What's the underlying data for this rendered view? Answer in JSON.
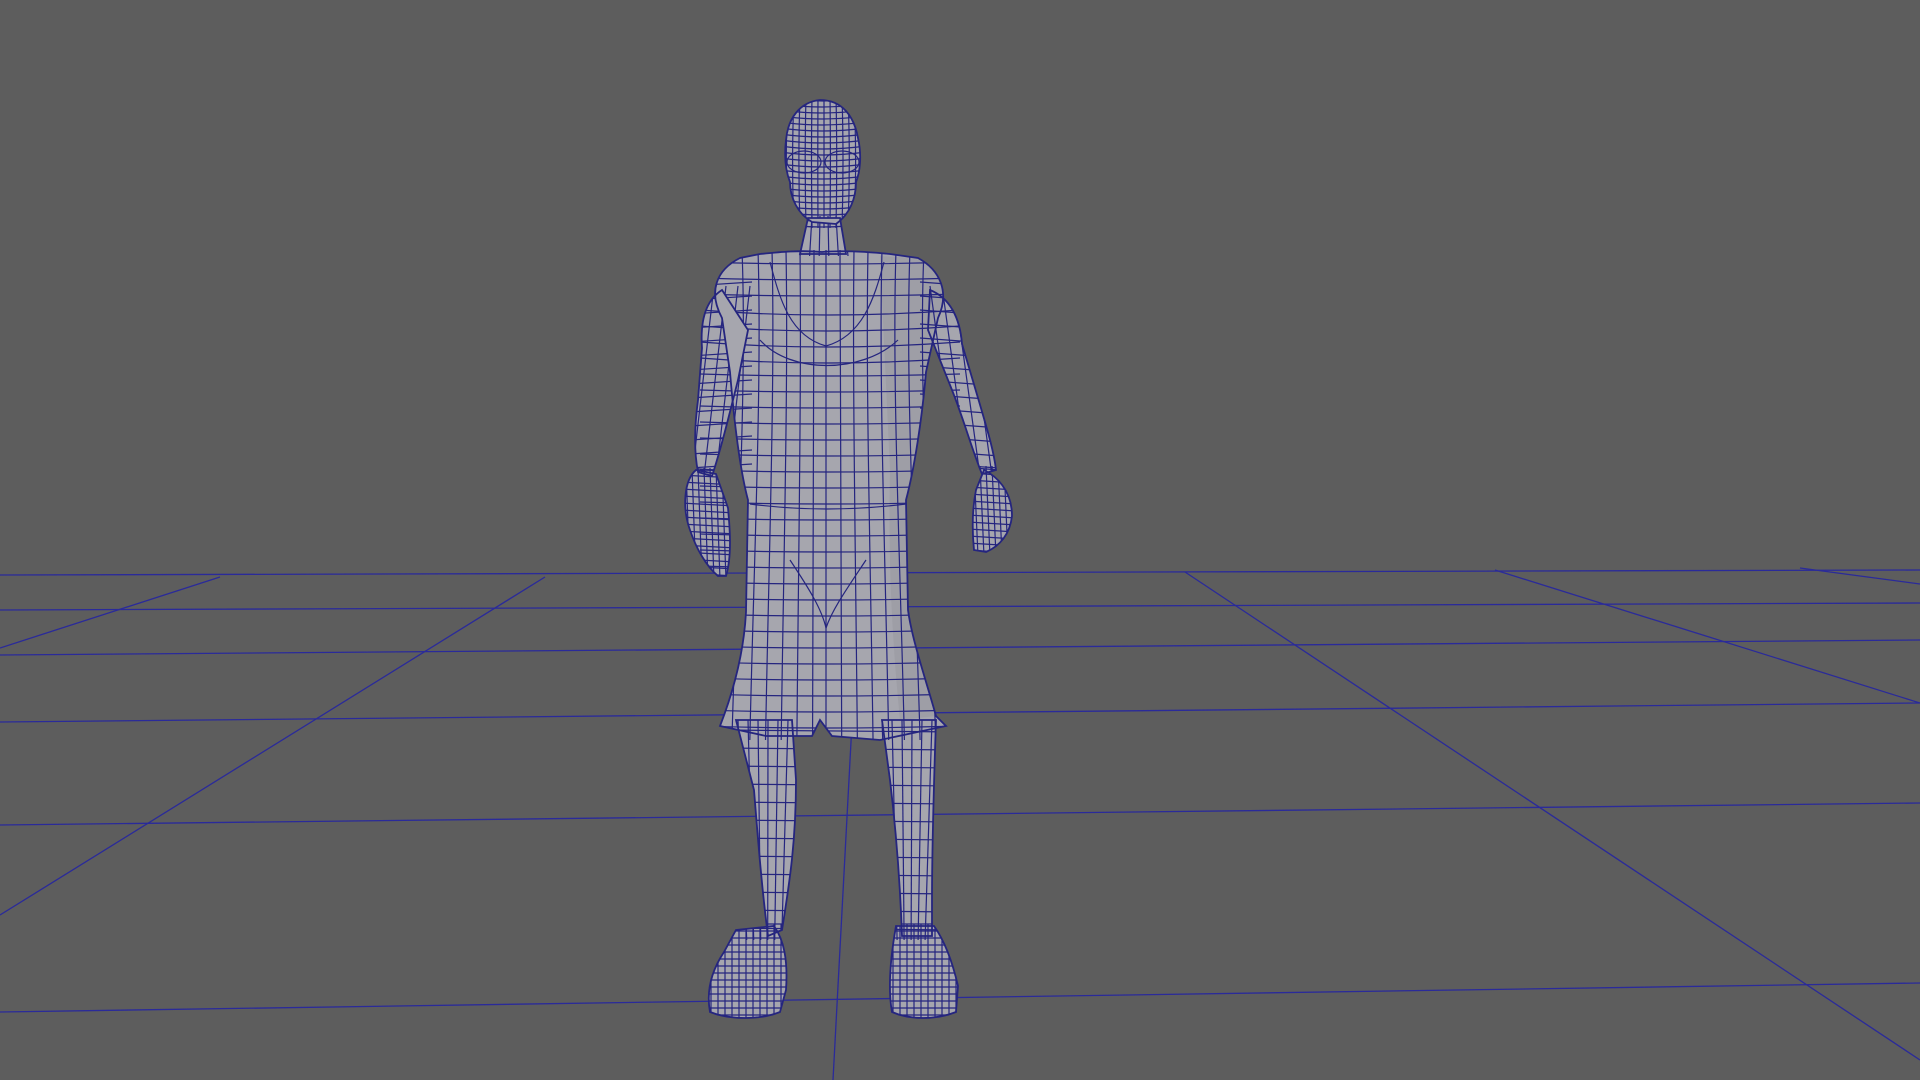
{
  "viewport": {
    "background_color": "#5d5d5d",
    "grid_color": "#2a2a9a",
    "wireframe_color": "#25257f",
    "mesh_fill_color": "#a6a6ae",
    "mesh_shadow_color": "#8e8e98"
  },
  "scene": {
    "model": "character-wireframe-mesh",
    "ground": "perspective-grid",
    "shading": "wireframe-on-shaded"
  }
}
